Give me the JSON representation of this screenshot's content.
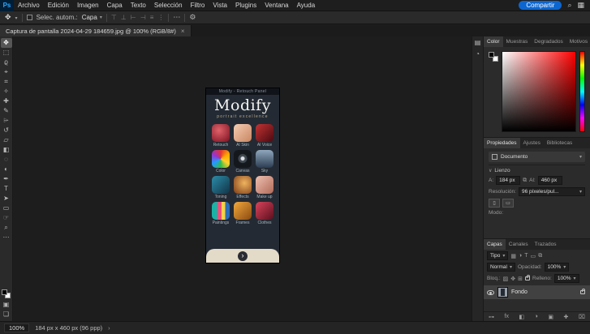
{
  "header": {
    "logo": "Ps",
    "menus": [
      "Archivo",
      "Edición",
      "Imagen",
      "Capa",
      "Texto",
      "Selección",
      "Filtro",
      "Vista",
      "Plugins",
      "Ventana",
      "Ayuda"
    ],
    "share_button": "Compartir",
    "search_icon": "⌕",
    "workspace_icon": "▦"
  },
  "options_bar": {
    "tool_icon": "✥",
    "auto_select_label": "Selec. autom.:",
    "auto_select_value": "Capa",
    "align_icons": [
      "⊤",
      "⊥",
      "⊢",
      "⊣",
      "≡",
      "⋮"
    ],
    "more_icon": "⋯",
    "settings_icon": "⚙"
  },
  "document_tab": {
    "title": "Captura de pantalla 2024-04-29 184659.jpg @ 100% (RGB/8#)",
    "close_icon": "×"
  },
  "tools": [
    {
      "name": "move",
      "glyph": "✥"
    },
    {
      "name": "rectangular-marquee",
      "glyph": "⬚"
    },
    {
      "name": "lasso",
      "glyph": "ϱ"
    },
    {
      "name": "object-selection",
      "glyph": "⌖"
    },
    {
      "name": "crop",
      "glyph": "⌗"
    },
    {
      "name": "eyedropper",
      "glyph": "✧"
    },
    {
      "name": "spot-healing-brush",
      "glyph": "✚"
    },
    {
      "name": "brush",
      "glyph": "✎"
    },
    {
      "name": "clone-stamp",
      "glyph": "⌲"
    },
    {
      "name": "history-brush",
      "glyph": "↺"
    },
    {
      "name": "eraser",
      "glyph": "▱"
    },
    {
      "name": "gradient",
      "glyph": "◧"
    },
    {
      "name": "blur",
      "glyph": "◌"
    },
    {
      "name": "dodge",
      "glyph": "◐"
    },
    {
      "name": "pen",
      "glyph": "✒"
    },
    {
      "name": "type",
      "glyph": "T"
    },
    {
      "name": "path-selection",
      "glyph": "➤"
    },
    {
      "name": "rectangle",
      "glyph": "▭"
    },
    {
      "name": "hand",
      "glyph": "☞"
    },
    {
      "name": "zoom",
      "glyph": "⌕"
    }
  ],
  "toolbar_extra": {
    "more_icon": "⋯",
    "quick_mask_icon": "▣",
    "screen_mode_icon": "❏"
  },
  "canvas_image": {
    "window_title": "Modify - Retouch Panel",
    "title": "Modify",
    "subtitle": "portrait excellence",
    "tiles": [
      {
        "label": "Retouch"
      },
      {
        "label": "AI Skin"
      },
      {
        "label": "AI Voice"
      },
      {
        "label": "Color"
      },
      {
        "label": "Canvas"
      },
      {
        "label": "Sky"
      },
      {
        "label": "Toning"
      },
      {
        "label": "Effects"
      },
      {
        "label": "Make up"
      },
      {
        "label": "Paintings"
      },
      {
        "label": "Frames"
      },
      {
        "label": "Clothes"
      }
    ],
    "next_button": "›"
  },
  "dock": {
    "icon_a": "▤",
    "icon_b": "◔"
  },
  "color_panel": {
    "tabs": [
      "Color",
      "Muestras",
      "Degradados",
      "Motivos"
    ]
  },
  "properties_panel": {
    "tabs": [
      "Propiedades",
      "Ajustes",
      "Bibliotecas"
    ],
    "document_row": "Documento",
    "section_label": "Lienzo",
    "width_label": "A:",
    "width_value": "184 px",
    "height_label": "Al:",
    "height_value": "460 px",
    "link_icon": "⧉",
    "resolution_label": "Resolución:",
    "resolution_value": "96 píxeles/pul...",
    "portrait_icon": "▯",
    "landscape_icon": "▭",
    "mode_label": "Modo:"
  },
  "layers_panel": {
    "tabs": [
      "Capas",
      "Canales",
      "Trazados"
    ],
    "filter_label": "Tipo",
    "filter_icons": [
      "▦",
      "◑",
      "T",
      "▭",
      "⧉"
    ],
    "blend_mode": "Normal",
    "opacity_label": "Opacidad:",
    "opacity_value": "100%",
    "lock_label": "Bloq.:",
    "lock_icons": [
      "▨",
      "✥",
      "⊞"
    ],
    "fill_label": "Relleno:",
    "fill_value": "100%",
    "layer_name": "Fondo",
    "footer_icons": [
      "⊶",
      "fx",
      "◧",
      "◑",
      "▣",
      "✚",
      "⌧"
    ]
  },
  "status_bar": {
    "zoom": "100%",
    "doc_info": "184 px x 460 px (96 ppp)",
    "chevron": "›"
  }
}
